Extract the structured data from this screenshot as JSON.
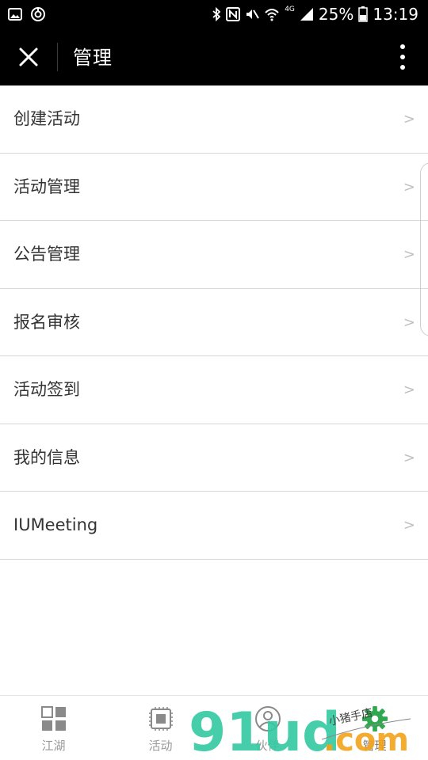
{
  "status_bar": {
    "battery_pct": "25%",
    "time": "13:19",
    "network": "4G",
    "left_icons": [
      "image-icon",
      "sync-icon"
    ],
    "right_icons": [
      "bluetooth-icon",
      "nfc-icon",
      "mute-icon",
      "wifi-icon",
      "signal-icon",
      "battery-icon"
    ]
  },
  "header": {
    "title": "管理",
    "close_icon": "close-icon",
    "more_icon": "more-vertical-icon"
  },
  "menu": {
    "arrow": ">",
    "items": [
      {
        "label": "创建活动"
      },
      {
        "label": "活动管理"
      },
      {
        "label": "公告管理"
      },
      {
        "label": "报名审核"
      },
      {
        "label": "活动签到"
      },
      {
        "label": "我的信息"
      },
      {
        "label": "IUMeeting"
      }
    ]
  },
  "tabbar": {
    "tabs": [
      {
        "label": "江湖",
        "icon": "grid-icon"
      },
      {
        "label": "活动",
        "icon": "chip-icon"
      },
      {
        "label": "伙伴",
        "icon": "partner-icon"
      },
      {
        "label": "管理",
        "icon": "gear-icon",
        "active": true
      }
    ]
  },
  "watermark": {
    "text": "91ud",
    "suffix": ".com",
    "caption": "小猪手店"
  },
  "colors": {
    "header_bg": "#000000",
    "divider": "#d8d8d8",
    "tab_label": "#9a9a9a",
    "active_gear": "#2fa84f",
    "watermark_green": "#32c8a0",
    "watermark_orange": "#f2a21a"
  }
}
